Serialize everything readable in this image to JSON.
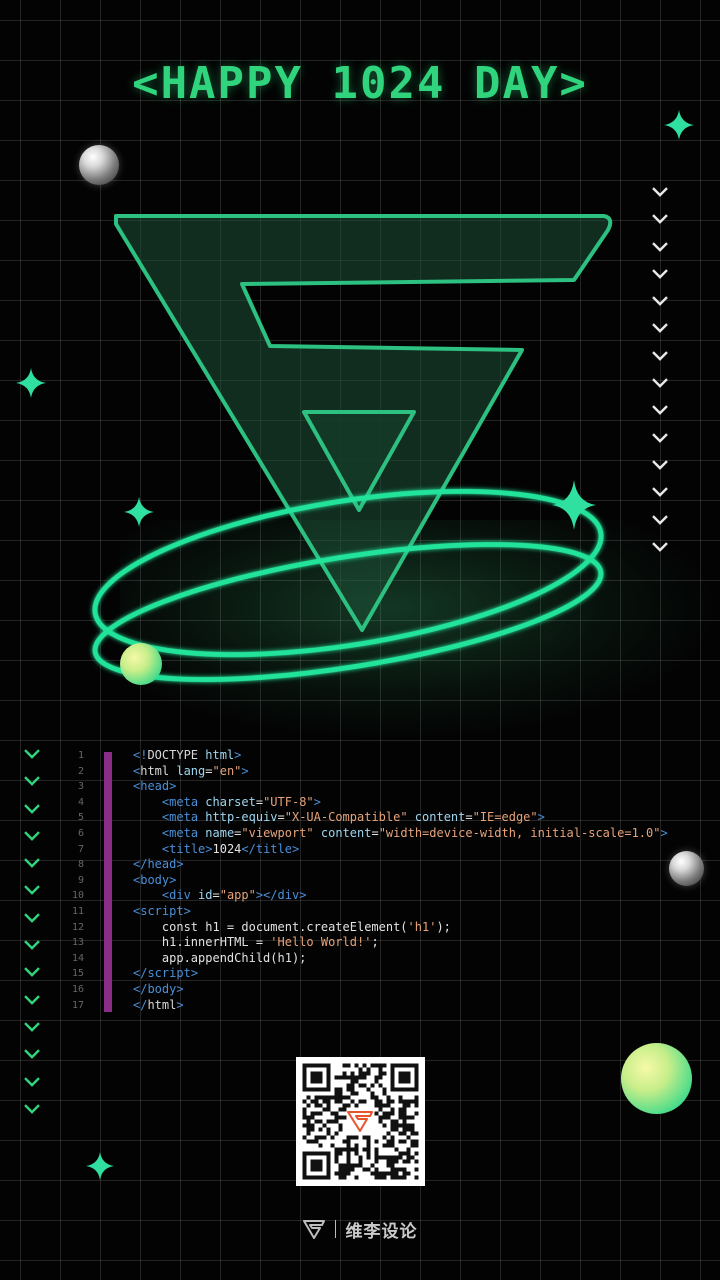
{
  "poster": {
    "headline": "<HAPPY 1024 DAY>"
  },
  "colors": {
    "accent_green": "#2fd47c",
    "ring_green": "#22e39a",
    "code_bar": "#8a2d86",
    "code_tag": "#4a8fd8",
    "code_attr": "#9dd6f0",
    "code_string": "#e6a37a"
  },
  "icons": {
    "sparkle": "four-point-star-icon",
    "chevron": "chevron-down-icon",
    "brand": "triangle-logo-icon"
  },
  "code": {
    "lines": [
      {
        "num": "1",
        "parts": [
          {
            "t": "tag",
            "v": "<!"
          },
          {
            "t": "name",
            "v": "DOCTYPE "
          },
          {
            "t": "attr",
            "v": "html"
          },
          {
            "t": "tag",
            "v": ">"
          }
        ]
      },
      {
        "num": "2",
        "parts": [
          {
            "t": "tag",
            "v": "<"
          },
          {
            "t": "name",
            "v": "html "
          },
          {
            "t": "attr",
            "v": "lang"
          },
          {
            "t": "txt",
            "v": "="
          },
          {
            "t": "str",
            "v": "\"en\""
          },
          {
            "t": "tag",
            "v": ">"
          }
        ]
      },
      {
        "num": "3",
        "parts": [
          {
            "t": "tag",
            "v": "<"
          },
          {
            "t": "tag",
            "v": "head"
          },
          {
            "t": "tag",
            "v": ">"
          }
        ]
      },
      {
        "num": "4",
        "parts": [
          {
            "t": "txt",
            "v": "    "
          },
          {
            "t": "tag",
            "v": "<"
          },
          {
            "t": "tag",
            "v": "meta "
          },
          {
            "t": "attr",
            "v": "charset"
          },
          {
            "t": "txt",
            "v": "="
          },
          {
            "t": "str",
            "v": "\"UTF-8\""
          },
          {
            "t": "tag",
            "v": ">"
          }
        ]
      },
      {
        "num": "5",
        "parts": [
          {
            "t": "txt",
            "v": "    "
          },
          {
            "t": "tag",
            "v": "<"
          },
          {
            "t": "tag",
            "v": "meta "
          },
          {
            "t": "attr",
            "v": "http-equiv"
          },
          {
            "t": "txt",
            "v": "="
          },
          {
            "t": "str",
            "v": "\"X-UA-Compatible\" "
          },
          {
            "t": "attr",
            "v": "content"
          },
          {
            "t": "txt",
            "v": "="
          },
          {
            "t": "str",
            "v": "\"IE=edge\""
          },
          {
            "t": "tag",
            "v": ">"
          }
        ]
      },
      {
        "num": "6",
        "parts": [
          {
            "t": "txt",
            "v": "    "
          },
          {
            "t": "tag",
            "v": "<"
          },
          {
            "t": "tag",
            "v": "meta "
          },
          {
            "t": "attr",
            "v": "name"
          },
          {
            "t": "txt",
            "v": "="
          },
          {
            "t": "str",
            "v": "\"viewport\" "
          },
          {
            "t": "attr",
            "v": "content"
          },
          {
            "t": "txt",
            "v": "="
          },
          {
            "t": "str",
            "v": "\"width=device-width, initial-scale=1.0\""
          },
          {
            "t": "tag",
            "v": ">"
          }
        ]
      },
      {
        "num": "7",
        "parts": [
          {
            "t": "txt",
            "v": "    "
          },
          {
            "t": "tag",
            "v": "<"
          },
          {
            "t": "tag",
            "v": "title"
          },
          {
            "t": "tag",
            "v": ">"
          },
          {
            "t": "txt",
            "v": "1024"
          },
          {
            "t": "tag",
            "v": "</"
          },
          {
            "t": "tag",
            "v": "title"
          },
          {
            "t": "tag",
            "v": ">"
          }
        ]
      },
      {
        "num": "8",
        "parts": [
          {
            "t": "tag",
            "v": "</"
          },
          {
            "t": "tag",
            "v": "head"
          },
          {
            "t": "tag",
            "v": ">"
          }
        ]
      },
      {
        "num": "9",
        "parts": [
          {
            "t": "tag",
            "v": "<"
          },
          {
            "t": "tag",
            "v": "body"
          },
          {
            "t": "tag",
            "v": ">"
          }
        ]
      },
      {
        "num": "10",
        "parts": [
          {
            "t": "txt",
            "v": "    "
          },
          {
            "t": "tag",
            "v": "<"
          },
          {
            "t": "tag",
            "v": "div "
          },
          {
            "t": "attr",
            "v": "id"
          },
          {
            "t": "txt",
            "v": "="
          },
          {
            "t": "str",
            "v": "\"app\""
          },
          {
            "t": "tag",
            "v": "></"
          },
          {
            "t": "tag",
            "v": "div"
          },
          {
            "t": "tag",
            "v": ">"
          }
        ]
      },
      {
        "num": "11",
        "parts": [
          {
            "t": "tag",
            "v": "<"
          },
          {
            "t": "tag",
            "v": "script"
          },
          {
            "t": "tag",
            "v": ">"
          }
        ]
      },
      {
        "num": "12",
        "parts": [
          {
            "t": "txt",
            "v": "    const h1 = document.createElement("
          },
          {
            "t": "str",
            "v": "'h1'"
          },
          {
            "t": "txt",
            "v": ");"
          }
        ]
      },
      {
        "num": "13",
        "parts": [
          {
            "t": "txt",
            "v": "    h1.innerHTML = "
          },
          {
            "t": "str",
            "v": "'Hello World!'"
          },
          {
            "t": "txt",
            "v": ";"
          }
        ]
      },
      {
        "num": "14",
        "parts": [
          {
            "t": "txt",
            "v": "    app.appendChild(h1);"
          }
        ]
      },
      {
        "num": "15",
        "parts": [
          {
            "t": "tag",
            "v": "</"
          },
          {
            "t": "tag",
            "v": "script"
          },
          {
            "t": "tag",
            "v": ">"
          }
        ]
      },
      {
        "num": "16",
        "parts": [
          {
            "t": "tag",
            "v": "</"
          },
          {
            "t": "tag",
            "v": "body"
          },
          {
            "t": "tag",
            "v": ">"
          }
        ]
      },
      {
        "num": "17",
        "parts": [
          {
            "t": "tag",
            "v": "</"
          },
          {
            "t": "name",
            "v": "html"
          },
          {
            "t": "tag",
            "v": ">"
          }
        ]
      }
    ]
  },
  "footer": {
    "brand_name": "维李设论"
  }
}
